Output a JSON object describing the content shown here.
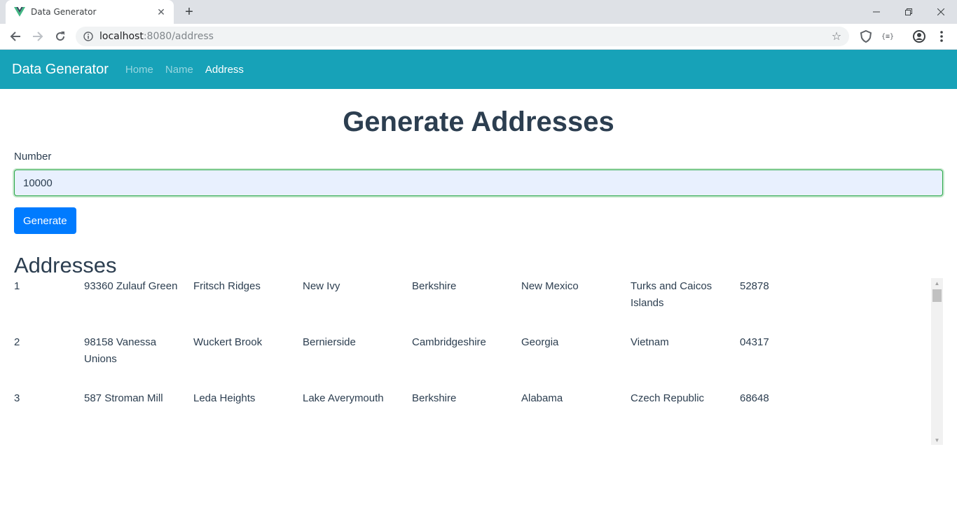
{
  "browser": {
    "tab_title": "Data Generator",
    "url_host": "localhost",
    "url_rest": ":8080/address"
  },
  "navbar": {
    "brand": "Data Generator",
    "links": [
      "Home",
      "Name",
      "Address"
    ],
    "active_link": "Address",
    "color": "#17a2b8"
  },
  "page": {
    "title": "Generate Addresses",
    "number_label": "Number",
    "number_value": "10000",
    "generate_label": "Generate",
    "section_title": "Addresses"
  },
  "addresses": [
    [
      "1",
      "93360 Zulauf Green",
      "Fritsch Ridges",
      "New Ivy",
      "Berkshire",
      "New Mexico",
      "Turks and Caicos Islands",
      "52878"
    ],
    [
      "2",
      "98158 Vanessa Unions",
      "Wuckert Brook",
      "Bernierside",
      "Cambridgeshire",
      "Georgia",
      "Vietnam",
      "04317"
    ],
    [
      "3",
      "587 Stroman Mill",
      "Leda Heights",
      "Lake Averymouth",
      "Berkshire",
      "Alabama",
      "Czech Republic",
      "68648"
    ]
  ],
  "colors": {
    "primary_button": "#007bff",
    "heading_text": "#2c3e50",
    "input_focus_border": "#28a745"
  }
}
